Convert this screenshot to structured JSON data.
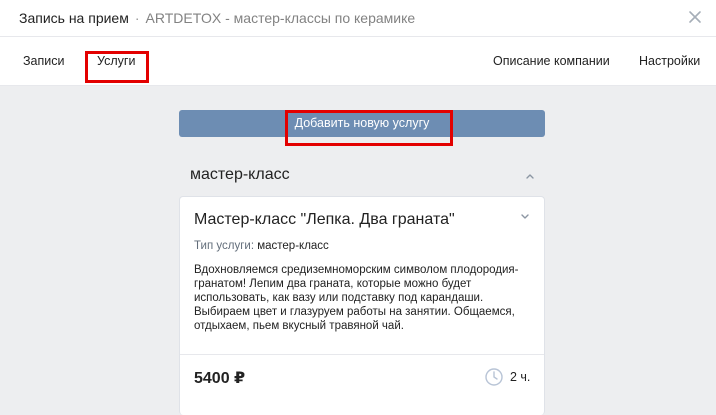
{
  "header": {
    "title": "Запись на прием",
    "separator": "·",
    "subtitle": "ARTDETOX - мастер-классы по керамике"
  },
  "tabs": [
    {
      "label": "Записи"
    },
    {
      "label": "Услуги"
    },
    {
      "label": "Описание компании"
    },
    {
      "label": "Настройки"
    }
  ],
  "add_button": {
    "label": "Добавить новую услугу"
  },
  "category": {
    "title": "мастер-класс"
  },
  "service": {
    "name": "Мастер-класс \"Лепка. Два граната\"",
    "type_label": "Тип услуги:",
    "type_value": "мастер-класс",
    "description": "Вдохновляемся средиземноморским символом плодородия-гранатом! Лепим два граната, которые можно будет использовать, как вазу или подставку под карандаши. Выбираем цвет и глазуруем работы на занятии. Общаемся, отдыхаем, пьем вкусный травяной чай.",
    "price": "5400 ₽",
    "duration": "2 ч."
  },
  "colors": {
    "accent_button": "#6d8db3",
    "highlight": "#e30000",
    "background": "#edeef0"
  },
  "icons": [
    "close-icon",
    "chevron-up-icon",
    "chevron-down-icon",
    "clock-icon"
  ]
}
